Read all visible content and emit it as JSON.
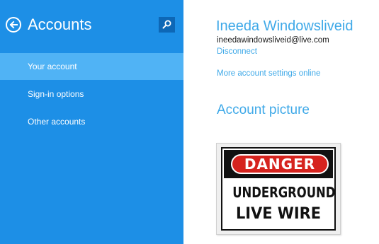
{
  "sidebar": {
    "title": "Accounts",
    "items": [
      {
        "label": "Your account",
        "selected": true
      },
      {
        "label": "Sign-in options",
        "selected": false
      },
      {
        "label": "Other accounts",
        "selected": false
      }
    ],
    "back_icon": "back-arrow-icon",
    "search_icon": "search-icon",
    "bg_color": "#1d8fe6",
    "selected_color": "#50b3f5"
  },
  "main": {
    "user_name": "Ineeda Windowsliveid",
    "email": "ineedawindowsliveid@live.com",
    "disconnect_link": "Disconnect",
    "more_settings_link": "More account settings online",
    "picture_section_title": "Account picture",
    "picture": {
      "header": "DANGER",
      "line1": "UNDERGROUND",
      "line2": "LIVE WIRE"
    },
    "accent_color": "#3fa9e8"
  }
}
